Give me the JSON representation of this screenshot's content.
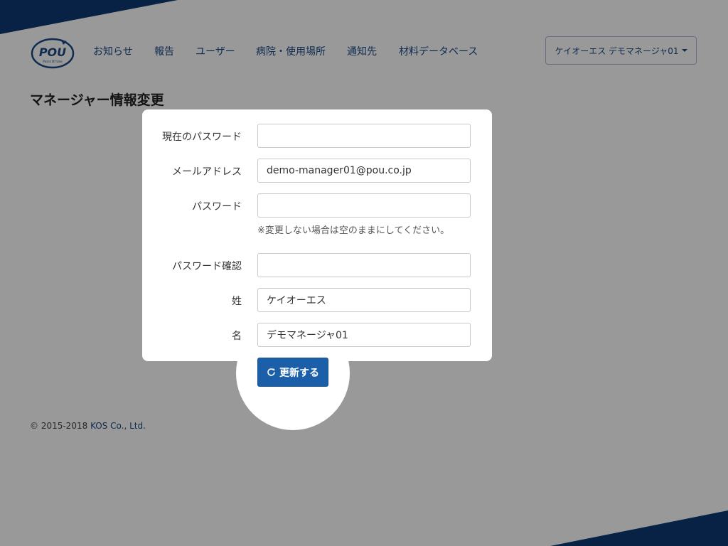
{
  "brand": {
    "logo_text": "POU",
    "logo_tagline": "Point Of Use"
  },
  "nav": {
    "items": [
      {
        "label": "お知らせ"
      },
      {
        "label": "報告"
      },
      {
        "label": "ユーザー"
      },
      {
        "label": "病院・使用場所"
      },
      {
        "label": "通知先"
      },
      {
        "label": "材料データベース"
      }
    ],
    "user_menu_label": "ケイオーエス デモマネージャ01"
  },
  "page": {
    "title": "マネージャー情報変更"
  },
  "form": {
    "current_password": {
      "label": "現在のパスワード",
      "value": ""
    },
    "email": {
      "label": "メールアドレス",
      "value": "demo-manager01@pou.co.jp"
    },
    "password": {
      "label": "パスワード",
      "value": "",
      "help": "※変更しない場合は空のままにしてください。"
    },
    "password_confirm": {
      "label": "パスワード確認",
      "value": ""
    },
    "last_name": {
      "label": "姓",
      "value": "ケイオーエス"
    },
    "first_name": {
      "label": "名",
      "value": "デモマネージャ01"
    },
    "submit_label": "更新する"
  },
  "footer": {
    "copyright": "© 2015-2018",
    "company": "KOS Co., Ltd."
  },
  "colors": {
    "brand_navy": "#0d3a72",
    "link_blue": "#1a4a86",
    "button_blue": "#1a5fa8"
  }
}
